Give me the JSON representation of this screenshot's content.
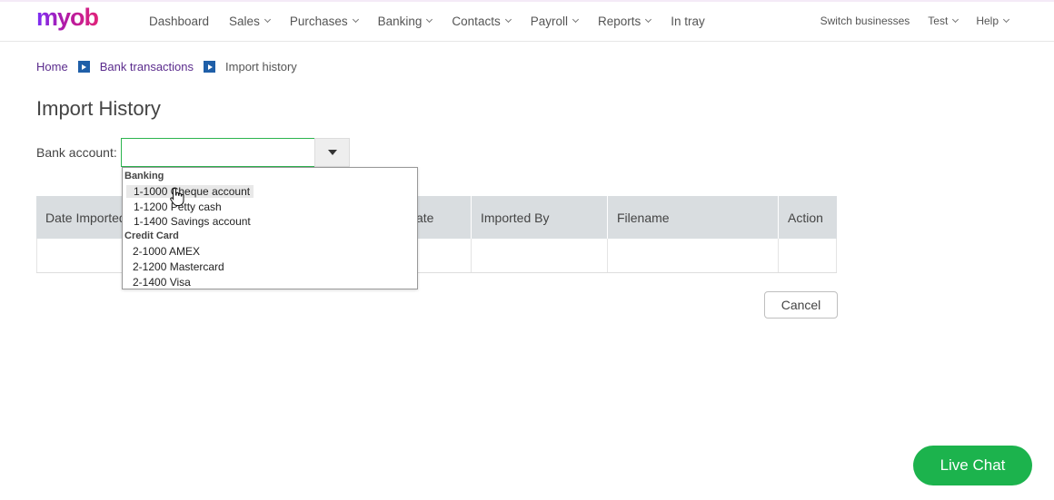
{
  "brand": {
    "logo": "myob"
  },
  "nav": {
    "items": [
      {
        "label": "Dashboard",
        "has_chevron": false
      },
      {
        "label": "Sales",
        "has_chevron": true
      },
      {
        "label": "Purchases",
        "has_chevron": true
      },
      {
        "label": "Banking",
        "has_chevron": true
      },
      {
        "label": "Contacts",
        "has_chevron": true
      },
      {
        "label": "Payroll",
        "has_chevron": true
      },
      {
        "label": "Reports",
        "has_chevron": true
      },
      {
        "label": "In tray",
        "has_chevron": false
      }
    ],
    "right": {
      "switch_businesses": "Switch businesses",
      "user": "Test",
      "help": "Help"
    }
  },
  "breadcrumb": {
    "home": "Home",
    "bank_transactions": "Bank transactions",
    "current": "Import history"
  },
  "page": {
    "title": "Import History"
  },
  "bank_account": {
    "label": "Bank account:",
    "value": "",
    "dropdown": {
      "groups": [
        {
          "name": "Banking",
          "options": [
            "1-1000 Cheque account",
            "1-1200 Petty cash",
            "1-1400 Savings account"
          ]
        },
        {
          "name": "Credit Card",
          "options": [
            "2-1000 AMEX",
            "2-1200 Mastercard",
            "2-1400 Visa"
          ]
        }
      ],
      "hovered_option": "1-1000 Cheque account"
    }
  },
  "table": {
    "columns": [
      "Date Imported",
      "Statement Date",
      "Imported By",
      "Filename",
      "Action"
    ],
    "visible_header_fragments": [
      "Date Imported",
      "ate",
      "Imported By",
      "Filename",
      "Action"
    ]
  },
  "actions": {
    "cancel": "Cancel"
  },
  "live_chat": {
    "label": "Live Chat"
  },
  "colors": {
    "brand_purple": "#7b2ff7",
    "brand_pink": "#e0237a",
    "link_purple": "#5b2c8d",
    "breadcrumb_arrow": "#1f5fa8",
    "focus_green": "#2cb44e",
    "live_chat_green": "#1cb34d",
    "table_header": "#d9dde0"
  }
}
